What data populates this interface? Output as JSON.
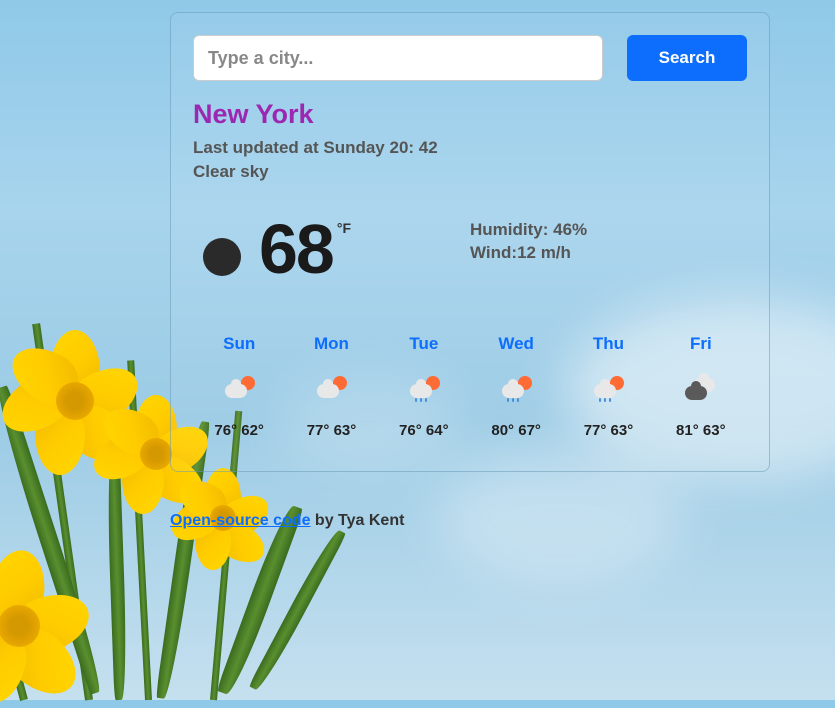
{
  "search": {
    "placeholder": "Type a city...",
    "button_label": "Search"
  },
  "city": "New York",
  "last_updated_prefix": "Last updated at ",
  "last_updated_time": "Sunday 20: 42",
  "description": "Clear sky",
  "current": {
    "temp": "68",
    "unit": "°F",
    "humidity_label": "Humidity: ",
    "humidity_value": "46%",
    "wind_label": "Wind:",
    "wind_value": "12 m/h"
  },
  "forecast": [
    {
      "day": "Sun",
      "icon": "partly-cloudy",
      "high": "76°",
      "low": "62°"
    },
    {
      "day": "Mon",
      "icon": "partly-cloudy",
      "high": "77°",
      "low": "63°"
    },
    {
      "day": "Tue",
      "icon": "rain",
      "high": "76°",
      "low": "64°"
    },
    {
      "day": "Wed",
      "icon": "rain",
      "high": "80°",
      "low": "67°"
    },
    {
      "day": "Thu",
      "icon": "rain",
      "high": "77°",
      "low": "63°"
    },
    {
      "day": "Fri",
      "icon": "dark-cloud",
      "high": "81°",
      "low": "63°"
    }
  ],
  "footer": {
    "link_text": "Open-source code",
    "by_text": " by Tya Kent"
  }
}
